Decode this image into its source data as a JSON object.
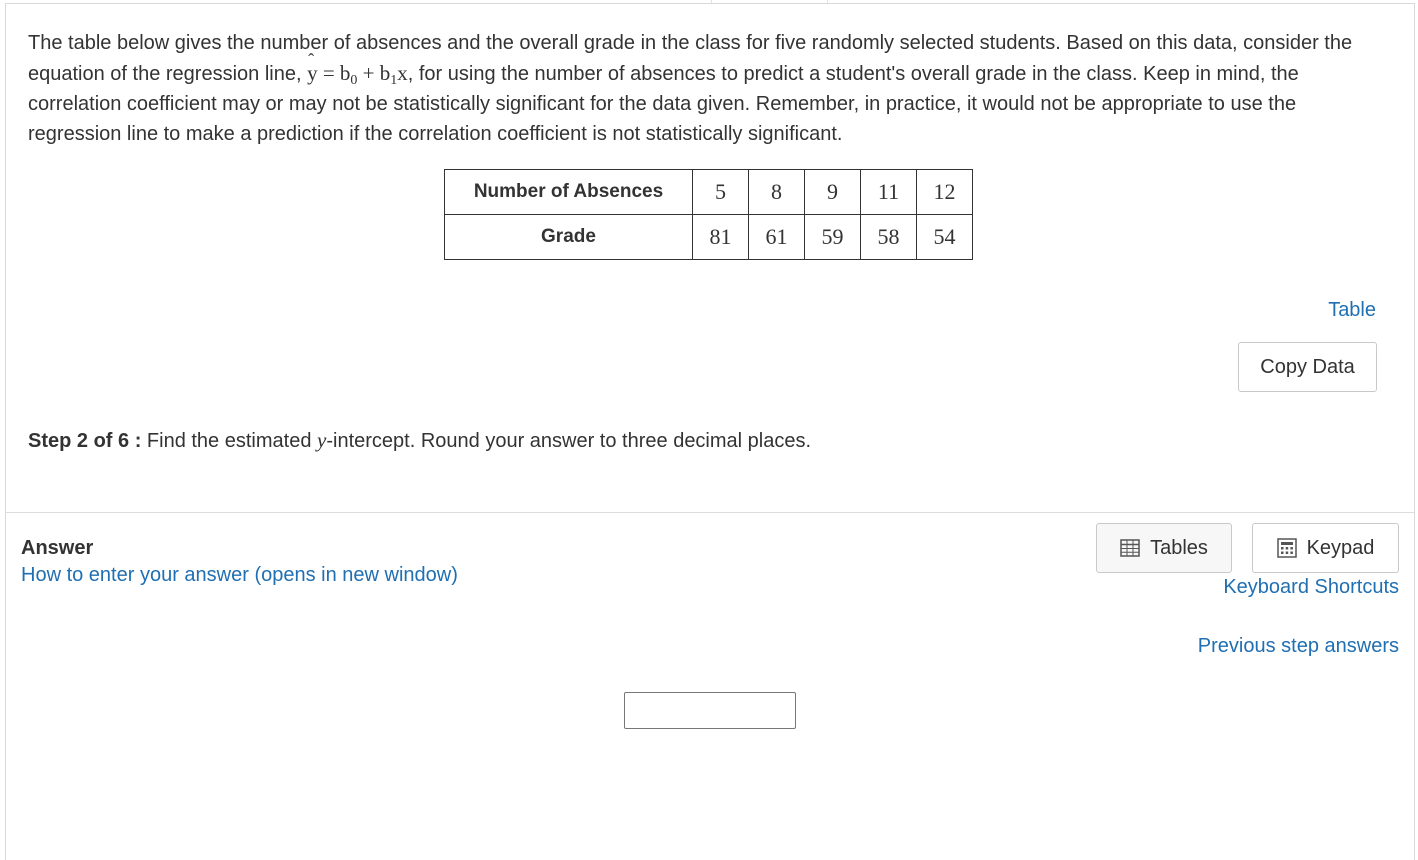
{
  "question": {
    "text_part1": "The table below gives the number of absences and the overall grade in the class for five randomly selected students. Based on this data, consider the equation of the regression line, ",
    "equation": {
      "lhs": "y",
      "eq": "=",
      "b0": "b",
      "b0_sub": "0",
      "plus": "+",
      "b1": "b",
      "b1_sub": "1",
      "x": "x"
    },
    "text_part2": ", for using the number of absences to predict a student's overall grade in the class. Keep in mind, the correlation coefficient may or may not be statistically significant for the data given. Remember, in practice, it would not be appropriate to use the regression line to make a prediction if the correlation coefficient is not statistically significant."
  },
  "data_table": {
    "rows": [
      {
        "header": "Number of Absences",
        "values": [
          "5",
          "8",
          "9",
          "11",
          "12"
        ]
      },
      {
        "header": "Grade",
        "values": [
          "81",
          "61",
          "59",
          "58",
          "54"
        ]
      }
    ]
  },
  "table_link": "Table",
  "copy_data_button": "Copy Data",
  "step": {
    "label": "Step 2 of 6 :",
    "text_before": " Find the estimated ",
    "variable": "y",
    "text_after": "-intercept. Round your answer to three decimal places."
  },
  "answer": {
    "label": "Answer",
    "howto_link": "How to enter your answer (opens in new window)",
    "input_value": ""
  },
  "tools": {
    "tables_button": "Tables",
    "keypad_button": "Keypad",
    "keyboard_shortcuts": "Keyboard Shortcuts",
    "previous_step_answers": "Previous step answers"
  },
  "colors": {
    "link": "#1f6fb2",
    "text": "#333333",
    "border": "#c9c9c9"
  }
}
